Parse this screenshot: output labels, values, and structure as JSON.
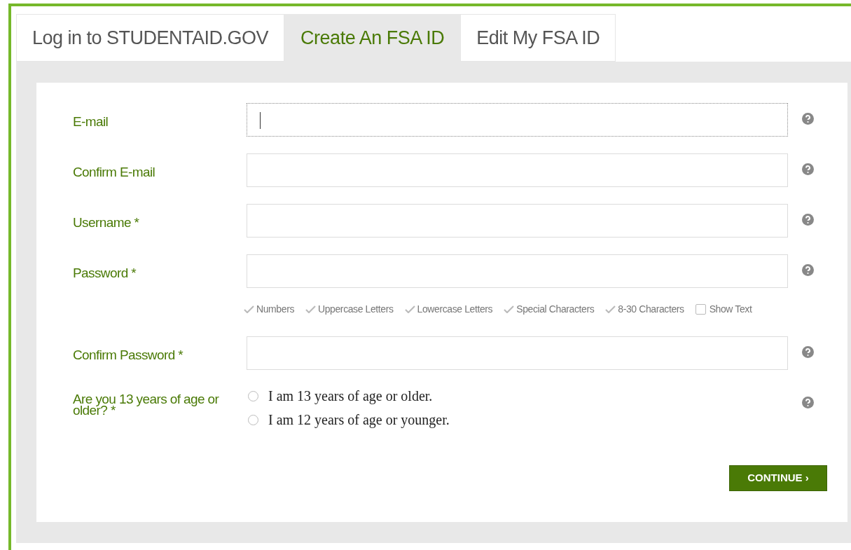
{
  "tabs": [
    {
      "label": "Log in to STUDENTAID.GOV",
      "selected": false
    },
    {
      "label": "Create An FSA ID",
      "selected": true
    },
    {
      "label": "Edit My FSA ID",
      "selected": false
    }
  ],
  "fields": [
    {
      "label": "E-mail",
      "focused": true
    },
    {
      "label": "Confirm E-mail",
      "focused": false
    },
    {
      "label": "Username *",
      "focused": false
    },
    {
      "label": "Password *",
      "focused": false,
      "requirements": [
        {
          "label": "Numbers",
          "met": false
        },
        {
          "label": "Uppercase Letters",
          "met": false
        },
        {
          "label": "Lowercase Letters",
          "met": false
        },
        {
          "label": "Special Characters",
          "met": false
        },
        {
          "label": "8-30 Characters",
          "met": false
        }
      ],
      "show_text": {
        "label": "Show Text",
        "checked": false
      }
    },
    {
      "label": "Confirm Password *",
      "focused": false
    }
  ],
  "age_question": {
    "label": "Are you 13 years of age or older? *",
    "options": [
      {
        "label": "I am 13 years of age or older.",
        "selected": false
      },
      {
        "label": "I am 12 years of age or younger.",
        "selected": false
      }
    ]
  },
  "continue_button": "CONTINUE ›"
}
